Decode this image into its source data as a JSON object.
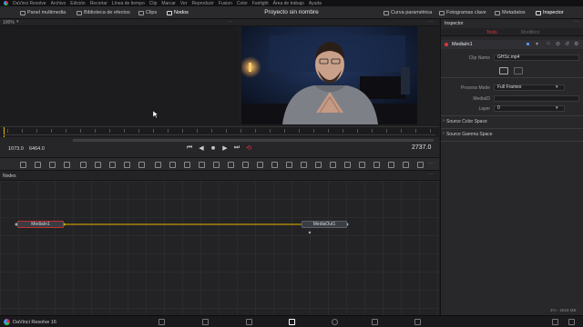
{
  "menu": [
    "DaVinci Resolve",
    "Archivo",
    "Edición",
    "Recortar",
    "Línea de tiempo",
    "Clip",
    "Marcar",
    "Ver",
    "Reproducir",
    "Fusion",
    "Color",
    "Fairlight",
    "Área de trabajo",
    "Ayuda"
  ],
  "toolbar": {
    "media_pool": "Panel multimedia",
    "effects_library": "Biblioteca de efectos",
    "clips": "Clips",
    "nodes": "Nodos",
    "project_title": "Proyecto sin nombre",
    "curves": "Curva paramétrica",
    "keyframes": "Fotogramas clave",
    "metadata": "Metadatos",
    "inspector": "Inspector"
  },
  "viewer": {
    "zoom": "100%"
  },
  "transport": {
    "start_frame": "1073.0",
    "end_frame": "6464.0",
    "current_frame": "2737.0"
  },
  "nodes_panel": {
    "title": "Nodes"
  },
  "nodes": {
    "media_in": "MediaIn1",
    "media_out": "MediaOut1"
  },
  "inspector": {
    "title": "Inspector",
    "tab_tools": "Tools",
    "tab_modifiers": "Modifiers",
    "node_name": "MediaIn1",
    "clip_name_label": "Clip Name",
    "clip_name_value": "GHSc.mp4",
    "process_mode_label": "Process Mode",
    "process_mode_value": "Full Frames",
    "mediaid_label": "MediaID",
    "layer_label": "Layer",
    "layer_value": "0",
    "source_color_space": "Source Color Space",
    "source_gamma_space": "Source Gamma Space"
  },
  "status": {
    "app_name": "DaVinci Resolve 16",
    "usage": "4% - 2818 MB"
  },
  "colors": {
    "accent_red": "#e0343c",
    "link_yellow": "#e8b600",
    "node_selected_border": "#c03030"
  },
  "icons": [
    "media-pool-icon",
    "effects-icon",
    "clips-icon",
    "nodes-icon",
    "curves-icon",
    "keyframes-icon",
    "metadata-icon",
    "inspector-icon",
    "play-icon",
    "stop-icon",
    "loop-icon"
  ]
}
